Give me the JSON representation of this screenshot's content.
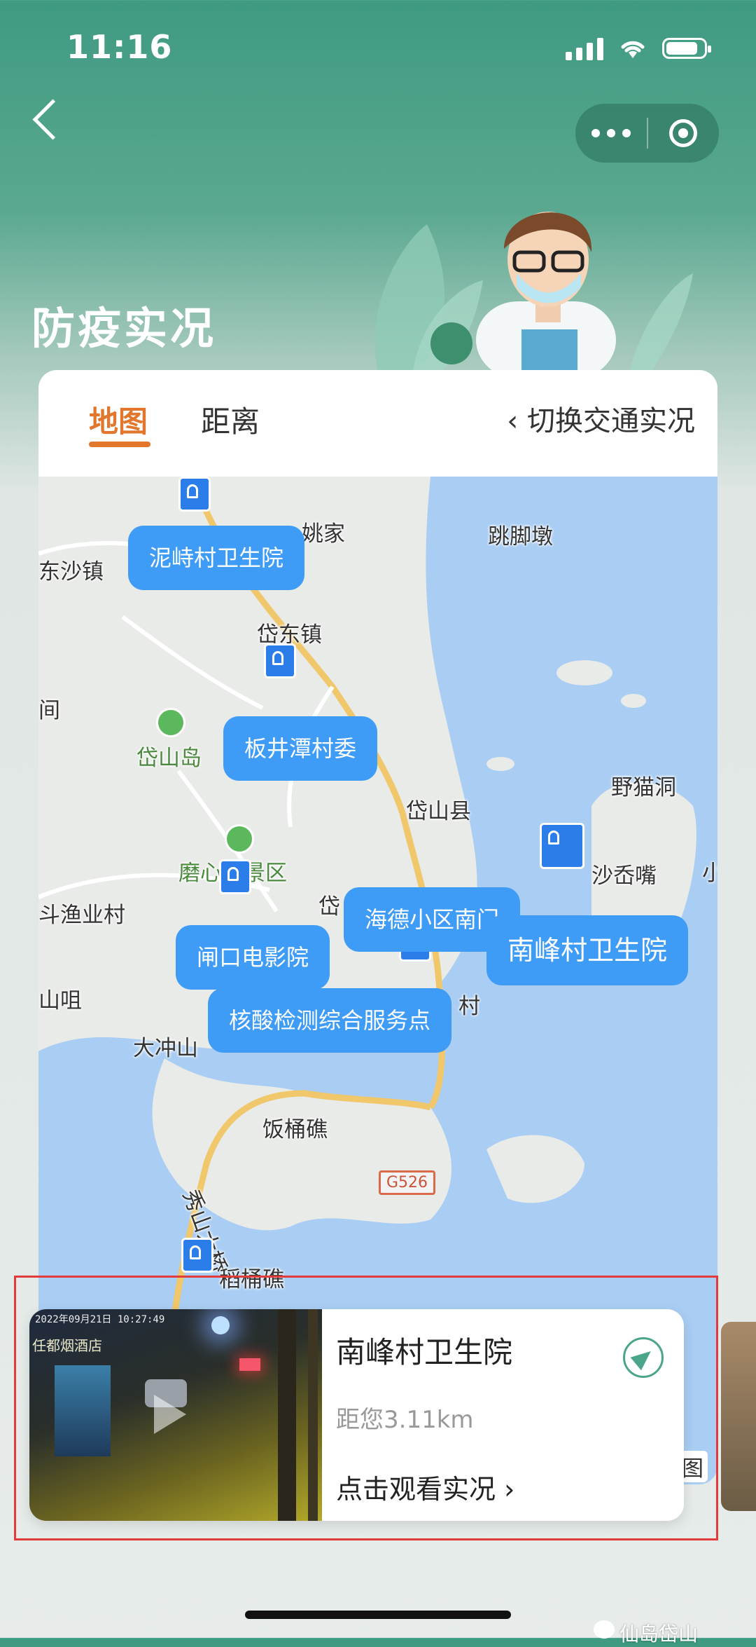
{
  "status_bar": {
    "time": "11:16"
  },
  "nav": {
    "back_label": "",
    "title": "防疫实况"
  },
  "tabs": [
    {
      "label": "地图",
      "active": true
    },
    {
      "label": "距离",
      "active": false
    }
  ],
  "switch_label": "‹ 切换交通实况",
  "map": {
    "place_labels": [
      "姚家",
      "跳脚墩",
      "东沙镇",
      "岱东镇",
      "间",
      "岱山岛",
      "野猫洞",
      "岱山县",
      "磨心山景区",
      "沙岙嘴",
      "小",
      "斗渔业村",
      "岱",
      "山咀",
      "村",
      "大冲山",
      "饭桶礁",
      "秀山大桥",
      "稻桶礁",
      "图"
    ],
    "road_label": "G526",
    "markers": [
      "泥峙村卫生院",
      "板井潭村委",
      "海德小区南门",
      "南峰村卫生院",
      "闸口电影院",
      "核酸检测综合服务点"
    ]
  },
  "info_card": {
    "camera_timestamp": "2022年09月21日 10:27:49",
    "camera_shop_sign": "任都烟酒店",
    "name": "南峰村卫生院",
    "distance": "距您3.11km",
    "watch": "点击观看实况 ›"
  },
  "watermark": "仙岛岱山",
  "colors": {
    "accent": "#e2762d",
    "marker": "#3e9bf6",
    "header": "#3f9a82",
    "highlight_box": "#e23b3b"
  }
}
